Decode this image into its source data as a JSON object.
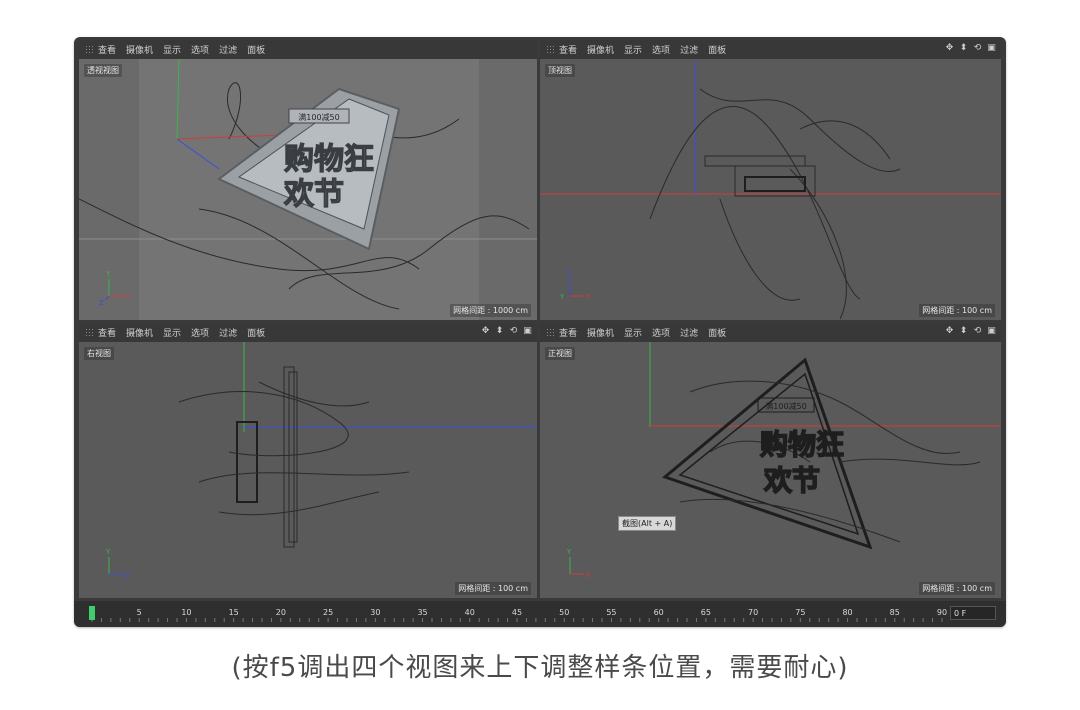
{
  "menus": [
    "查看",
    "摄像机",
    "显示",
    "选项",
    "过滤",
    "面板"
  ],
  "nav_icons": [
    "move-icon",
    "zoom-icon",
    "rotate-icon",
    "maximize-icon"
  ],
  "viewports": {
    "perspective": {
      "label": "透视视图",
      "grid": "网格间距 : 1000 cm"
    },
    "top": {
      "label": "顶视图",
      "grid": "网格间距 : 100 cm"
    },
    "right": {
      "label": "右视图",
      "grid": "网格间距 : 100 cm"
    },
    "front": {
      "label": "正视图",
      "grid": "网格间距 : 100 cm"
    }
  },
  "scene_text": {
    "logo_line1": "购物狂",
    "logo_line2": "欢节",
    "badge": "满100减50",
    "badge_persp": "满100减50"
  },
  "tooltip": "截图(Alt + A)",
  "timeline": {
    "ticks": [
      "0",
      "5",
      "10",
      "15",
      "20",
      "25",
      "30",
      "35",
      "40",
      "45",
      "50",
      "55",
      "60",
      "65",
      "70",
      "75",
      "80",
      "85",
      "90"
    ],
    "current_frame": "0 F",
    "playhead": 0
  },
  "caption": "(按f5调出四个视图来上下调整样条位置，需要耐心)",
  "colors": {
    "x_axis": "#d23b3b",
    "y_axis": "#3ab54a",
    "z_axis": "#3a4fd6",
    "playhead": "#3fcf6a"
  }
}
